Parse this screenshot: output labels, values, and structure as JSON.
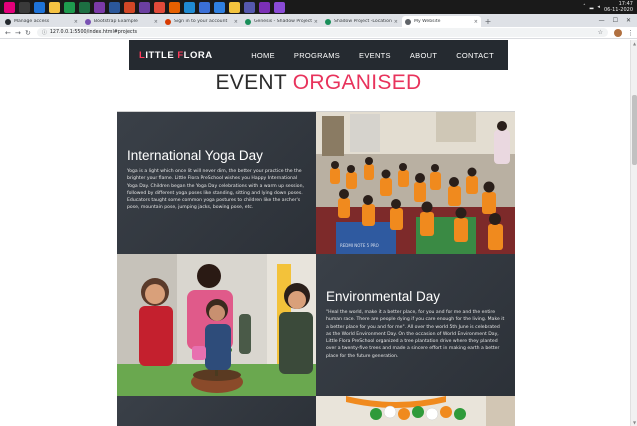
{
  "taskbar": {
    "apps": [
      {
        "name": "start-icon",
        "color": "#e3007a"
      },
      {
        "name": "terminal-icon",
        "color": "#3a3a3a"
      },
      {
        "name": "edge-icon",
        "color": "#1e73d8"
      },
      {
        "name": "file-explorer-icon",
        "color": "#f5c242"
      },
      {
        "name": "sheets-icon",
        "color": "#1e9b4e"
      },
      {
        "name": "excel-icon",
        "color": "#1d6f42"
      },
      {
        "name": "onenote-icon",
        "color": "#7b3aa8"
      },
      {
        "name": "word-icon",
        "color": "#2b579a"
      },
      {
        "name": "powerpoint-icon",
        "color": "#d24726"
      },
      {
        "name": "visual-studio-icon",
        "color": "#6b3fa0"
      },
      {
        "name": "chrome-icon",
        "color": "#e04a3a"
      },
      {
        "name": "firefox-icon",
        "color": "#e66000"
      },
      {
        "name": "vscode-icon",
        "color": "#1f8ad2"
      },
      {
        "name": "notepad-icon",
        "color": "#3a6fd6"
      },
      {
        "name": "app-blue-icon",
        "color": "#2f7fe0"
      },
      {
        "name": "folder-icon",
        "color": "#f3c33e"
      },
      {
        "name": "teams-icon",
        "color": "#5558af"
      },
      {
        "name": "onenote2-icon",
        "color": "#7b2fb5"
      },
      {
        "name": "vs2-icon",
        "color": "#8a4bd6"
      }
    ],
    "time": "17:47",
    "date": "06-11-2020"
  },
  "browser": {
    "tabs": [
      {
        "label": "Manage access",
        "color": "#24292e"
      },
      {
        "label": "Bootstrap Example",
        "color": "#7952b3"
      },
      {
        "label": "Sign in to your account",
        "color": "#d83b01"
      },
      {
        "label": "Genesis - Shadow Project Deta...",
        "color": "#1a8f5a"
      },
      {
        "label": "Shadow Project -Location and N...",
        "color": "#1a8f5a"
      },
      {
        "label": "My Website",
        "color": "#5f6368",
        "active": true
      }
    ],
    "url": "127.0.0.1:5500/index.html#projects"
  },
  "site": {
    "logo_first": "L",
    "logo_mid": "ITTLE ",
    "logo_f": "F",
    "logo_rest": "LORA",
    "menu": [
      "HOME",
      "PROGRAMS",
      "EVENTS",
      "ABOUT",
      "CONTACT"
    ],
    "heading_part1": "EVENT ",
    "heading_part2": "ORGANISED",
    "accent_color": "#e8335c",
    "nav_color": "#252a30"
  },
  "events": [
    {
      "title": "International Yoga Day",
      "text": "Yoga is a light which once lit will never dim, the better your practice the the brighter your flame. Little Flora PreSchool wishes you Happy International Yoga Day. Children began the Yoga Day celebrations with a warm up session, followed by different yoga poses like standing, sitting and lying down poses. Educators taught some common yoga postures to children like the archer's pose, mountain pose, jumping jacks, bowing pose, etc."
    },
    {
      "title": "Environmental Day",
      "text": "\"Heal the world, make it a better place, for you and for me and the entire human race. There are people dying if you care enough for the living. Make it a better place for you and for me\". All over the world 5th June is celebrated as the World Environment Day. On the occasion of World Environment Day, Little Flora PreSchool organized a tree plantation drive where they planted over a twenty-five trees and made a sincere effort in making earth a better place for the future generation."
    }
  ],
  "photo_watermark": "REDMI NOTE 5 PRO"
}
